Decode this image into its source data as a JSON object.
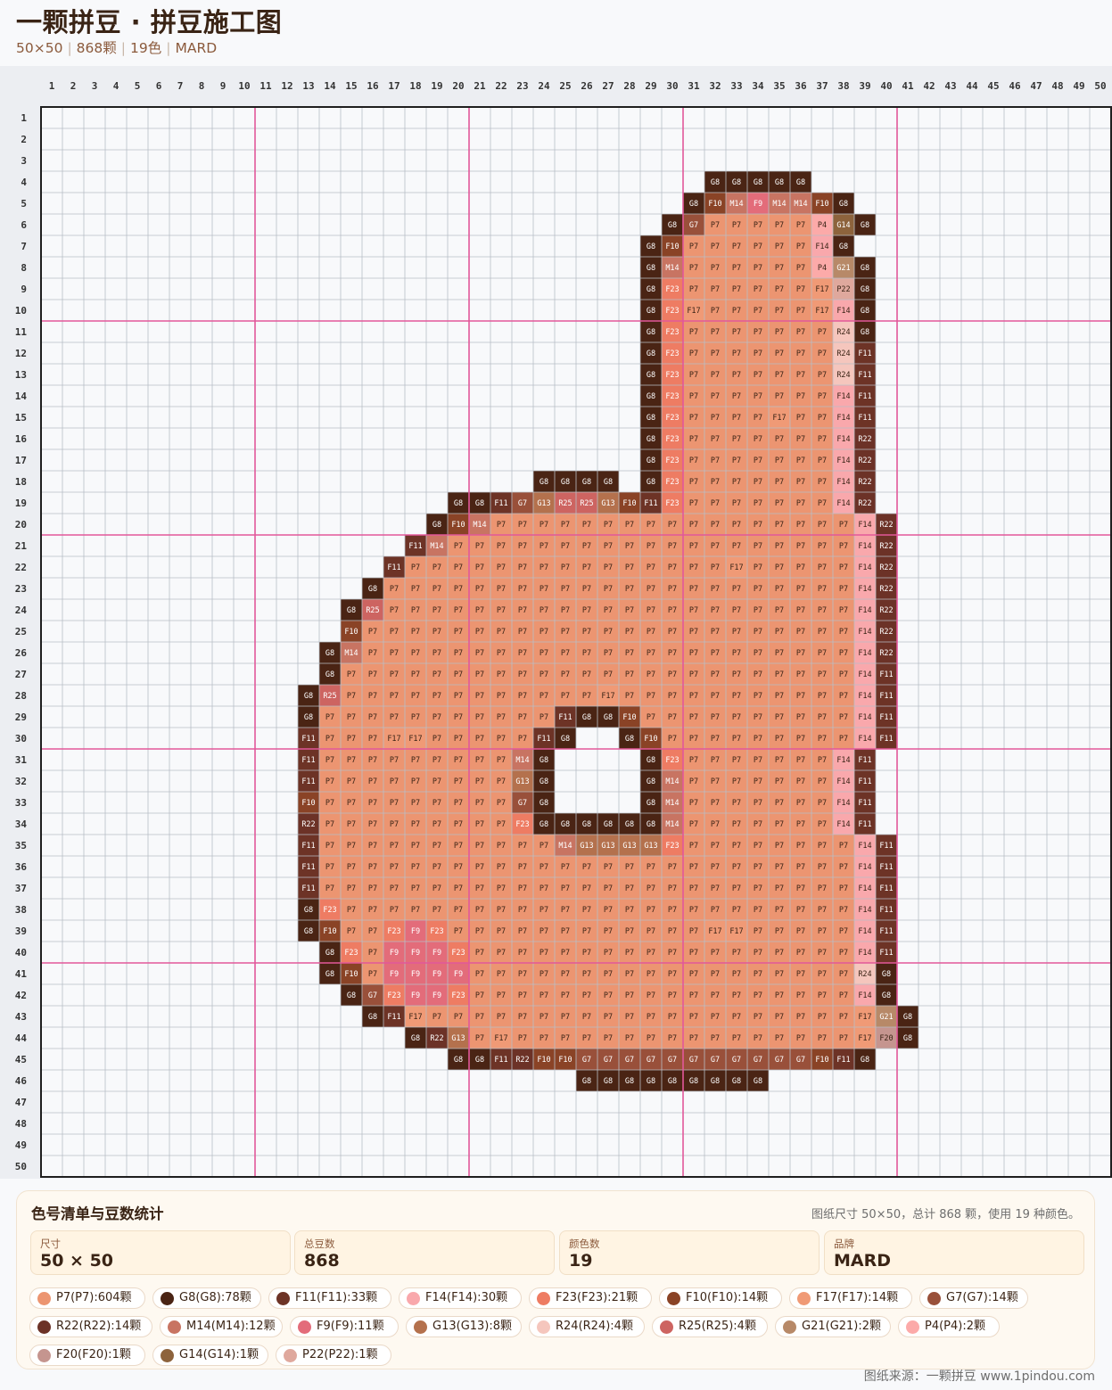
{
  "header": {
    "title": "一颗拼豆 · 拼豆施工图",
    "info": [
      "50×50",
      "868颗",
      "19色",
      "MARD"
    ]
  },
  "grid": {
    "cols": 50,
    "rows": 50,
    "major_every": 10,
    "major_color": "#e2589a",
    "minor_color": "#b8bec6",
    "border_color": "#1f1f1f",
    "cell_bg": "#f8f9fb",
    "rows_data": [
      [],
      [],
      [],
      [
        [
          32,
          "G8",
          "G8",
          "G8",
          "G8",
          "G8"
        ]
      ],
      [
        [
          31,
          "G8",
          "F10",
          "M14",
          "F9",
          "M14",
          "M14",
          "F10",
          "G8"
        ]
      ],
      [
        [
          30,
          "G8",
          "G7",
          "P7",
          "P7",
          "P7",
          "P7",
          "P7",
          "P4",
          "G14",
          "G8"
        ]
      ],
      [
        [
          29,
          "G8",
          "F10",
          "P7",
          "P7",
          "P7",
          "P7",
          "P7",
          "P7",
          "F14",
          "G8"
        ]
      ],
      [
        [
          29,
          "G8",
          "M14",
          "P7",
          "P7",
          "P7",
          "P7",
          "P7",
          "P7",
          "P4",
          "G21",
          "G8"
        ]
      ],
      [
        [
          29,
          "G8",
          "F23",
          "P7",
          "P7",
          "P7",
          "P7",
          "P7",
          "P7",
          "F17",
          "P22",
          "G8"
        ]
      ],
      [
        [
          29,
          "G8",
          "F23",
          "F17",
          "P7",
          "P7",
          "P7",
          "P7",
          "P7",
          "F17",
          "F14",
          "G8"
        ]
      ],
      [
        [
          29,
          "G8",
          "F23",
          "P7",
          "P7",
          "P7",
          "P7",
          "P7",
          "P7",
          "P7",
          "R24",
          "G8"
        ]
      ],
      [
        [
          29,
          "G8",
          "F23",
          "P7",
          "P7",
          "P7",
          "P7",
          "P7",
          "P7",
          "P7",
          "R24",
          "F11"
        ]
      ],
      [
        [
          29,
          "G8",
          "F23",
          "P7",
          "P7",
          "P7",
          "P7",
          "P7",
          "P7",
          "P7",
          "R24",
          "F11"
        ]
      ],
      [
        [
          29,
          "G8",
          "F23",
          "P7",
          "P7",
          "P7",
          "P7",
          "P7",
          "P7",
          "P7",
          "F14",
          "F11"
        ]
      ],
      [
        [
          29,
          "G8",
          "F23",
          "P7",
          "P7",
          "P7",
          "P7",
          "F17",
          "P7",
          "P7",
          "F14",
          "F11"
        ]
      ],
      [
        [
          29,
          "G8",
          "F23",
          "P7",
          "P7",
          "P7",
          "P7",
          "P7",
          "P7",
          "P7",
          "F14",
          "R22"
        ]
      ],
      [
        [
          29,
          "G8",
          "F23",
          "P7",
          "P7",
          "P7",
          "P7",
          "P7",
          "P7",
          "P7",
          "F14",
          "R22"
        ]
      ],
      [
        [
          24,
          "G8",
          "G8",
          "G8",
          "G8"
        ],
        [
          29,
          "G8",
          "F23",
          "P7",
          "P7",
          "P7",
          "P7",
          "P7",
          "P7",
          "P7",
          "F14",
          "R22"
        ]
      ],
      [
        [
          20,
          "G8",
          "G8",
          "F11",
          "G7",
          "G13",
          "R25",
          "R25",
          "G13",
          "F10",
          "F11",
          "F23",
          "P7",
          "P7",
          "P7",
          "P7",
          "P7",
          "P7",
          "P7",
          "F14",
          "R22"
        ]
      ],
      [
        [
          19,
          "G8",
          "F10",
          "M14",
          "P7",
          "P7",
          "P7",
          "P7",
          "P7",
          "P7",
          "P7",
          "P7",
          "P7",
          "P7",
          "P7",
          "P7",
          "P7",
          "P7",
          "P7",
          "P7",
          "P7",
          "F14",
          "R22"
        ]
      ],
      [
        [
          18,
          "F11",
          "M14",
          "P7",
          "P7",
          "P7",
          "P7",
          "P7",
          "P7",
          "P7",
          "P7",
          "P7",
          "P7",
          "P7",
          "P7",
          "P7",
          "P7",
          "P7",
          "P7",
          "P7",
          "P7",
          "P7",
          "F14",
          "R22"
        ]
      ],
      [
        [
          17,
          "F11",
          "P7",
          "P7",
          "P7",
          "P7",
          "P7",
          "P7",
          "P7",
          "P7",
          "P7",
          "P7",
          "P7",
          "P7",
          "P7",
          "P7",
          "P7",
          "F17",
          "P7",
          "P7",
          "P7",
          "P7",
          "P7",
          "F14",
          "R22"
        ]
      ],
      [
        [
          16,
          "G8",
          "P7",
          "P7",
          "P7",
          "P7",
          "P7",
          "P7",
          "P7",
          "P7",
          "P7",
          "P7",
          "P7",
          "P7",
          "P7",
          "P7",
          "P7",
          "P7",
          "P7",
          "P7",
          "P7",
          "P7",
          "P7",
          "P7",
          "F14",
          "R22"
        ]
      ],
      [
        [
          15,
          "G8",
          "R25",
          "P7",
          "P7",
          "P7",
          "P7",
          "P7",
          "P7",
          "P7",
          "P7",
          "P7",
          "P7",
          "P7",
          "P7",
          "P7",
          "P7",
          "P7",
          "P7",
          "P7",
          "P7",
          "P7",
          "P7",
          "P7",
          "P7",
          "F14",
          "R22"
        ]
      ],
      [
        [
          15,
          "F10",
          "P7",
          "P7",
          "P7",
          "P7",
          "P7",
          "P7",
          "P7",
          "P7",
          "P7",
          "P7",
          "P7",
          "P7",
          "P7",
          "P7",
          "P7",
          "P7",
          "P7",
          "P7",
          "P7",
          "P7",
          "P7",
          "P7",
          "P7",
          "F14",
          "R22"
        ]
      ],
      [
        [
          14,
          "G8",
          "M14",
          "P7",
          "P7",
          "P7",
          "P7",
          "P7",
          "P7",
          "P7",
          "P7",
          "P7",
          "P7",
          "P7",
          "P7",
          "P7",
          "P7",
          "P7",
          "P7",
          "P7",
          "P7",
          "P7",
          "P7",
          "P7",
          "P7",
          "P7",
          "F14",
          "R22"
        ]
      ],
      [
        [
          14,
          "G8",
          "P7",
          "P7",
          "P7",
          "P7",
          "P7",
          "P7",
          "P7",
          "P7",
          "P7",
          "P7",
          "P7",
          "P7",
          "P7",
          "P7",
          "P7",
          "P7",
          "P7",
          "P7",
          "P7",
          "P7",
          "P7",
          "P7",
          "P7",
          "P7",
          "F14",
          "F11"
        ]
      ],
      [
        [
          13,
          "G8",
          "R25",
          "P7",
          "P7",
          "P7",
          "P7",
          "P7",
          "P7",
          "P7",
          "P7",
          "P7",
          "P7",
          "P7",
          "P7",
          "F17",
          "P7",
          "P7",
          "P7",
          "P7",
          "P7",
          "P7",
          "P7",
          "P7",
          "P7",
          "P7",
          "P7",
          "F14",
          "F11"
        ]
      ],
      [
        [
          13,
          "G8",
          "P7",
          "P7",
          "P7",
          "P7",
          "P7",
          "P7",
          "P7",
          "P7",
          "P7",
          "P7",
          "P7",
          "F11",
          "G8",
          "G8",
          "F10",
          "P7",
          "P7",
          "P7",
          "P7",
          "P7",
          "P7",
          "P7",
          "P7",
          "P7",
          "P7",
          "F14",
          "F11"
        ]
      ],
      [
        [
          13,
          "F11",
          "P7",
          "P7",
          "P7",
          "F17",
          "F17",
          "P7",
          "P7",
          "P7",
          "P7",
          "P7",
          "F11",
          "G8"
        ],
        [
          28,
          "G8",
          "F10",
          "P7",
          "P7",
          "P7",
          "P7",
          "P7",
          "P7",
          "P7",
          "P7",
          "P7",
          "F14",
          "F11"
        ]
      ],
      [
        [
          13,
          "F11",
          "P7",
          "P7",
          "P7",
          "P7",
          "P7",
          "P7",
          "P7",
          "P7",
          "P7",
          "M14",
          "G8"
        ],
        [
          29,
          "G8",
          "F23",
          "P7",
          "P7",
          "P7",
          "P7",
          "P7",
          "P7",
          "P7",
          "F14",
          "F11"
        ]
      ],
      [
        [
          13,
          "F11",
          "P7",
          "P7",
          "P7",
          "P7",
          "P7",
          "P7",
          "P7",
          "P7",
          "P7",
          "G13",
          "G8"
        ],
        [
          29,
          "G8",
          "M14",
          "P7",
          "P7",
          "P7",
          "P7",
          "P7",
          "P7",
          "P7",
          "F14",
          "F11"
        ]
      ],
      [
        [
          13,
          "F10",
          "P7",
          "P7",
          "P7",
          "P7",
          "P7",
          "P7",
          "P7",
          "P7",
          "P7",
          "G7",
          "G8"
        ],
        [
          29,
          "G8",
          "M14",
          "P7",
          "P7",
          "P7",
          "P7",
          "P7",
          "P7",
          "P7",
          "F14",
          "F11"
        ]
      ],
      [
        [
          13,
          "R22",
          "P7",
          "P7",
          "P7",
          "P7",
          "P7",
          "P7",
          "P7",
          "P7",
          "P7",
          "F23",
          "G8",
          "G8",
          "G8",
          "G8",
          "G8",
          "G8",
          "M14",
          "P7",
          "P7",
          "P7",
          "P7",
          "P7",
          "P7",
          "P7",
          "F14",
          "F11"
        ]
      ],
      [
        [
          13,
          "F11",
          "P7",
          "P7",
          "P7",
          "P7",
          "P7",
          "P7",
          "P7",
          "P7",
          "P7",
          "P7",
          "P7",
          "M14",
          "G13",
          "G13",
          "G13",
          "G13",
          "F23",
          "P7",
          "P7",
          "P7",
          "P7",
          "P7",
          "P7",
          "P7",
          "P7",
          "F14",
          "F11"
        ]
      ],
      [
        [
          13,
          "F11",
          "P7",
          "P7",
          "P7",
          "P7",
          "P7",
          "P7",
          "P7",
          "P7",
          "P7",
          "P7",
          "P7",
          "P7",
          "P7",
          "P7",
          "P7",
          "P7",
          "P7",
          "P7",
          "P7",
          "P7",
          "P7",
          "P7",
          "P7",
          "P7",
          "P7",
          "F14",
          "F11"
        ]
      ],
      [
        [
          13,
          "F11",
          "P7",
          "P7",
          "P7",
          "P7",
          "P7",
          "P7",
          "P7",
          "P7",
          "P7",
          "P7",
          "P7",
          "P7",
          "P7",
          "P7",
          "P7",
          "P7",
          "P7",
          "P7",
          "P7",
          "P7",
          "P7",
          "P7",
          "P7",
          "P7",
          "P7",
          "F14",
          "F11"
        ]
      ],
      [
        [
          13,
          "G8",
          "F23",
          "P7",
          "P7",
          "P7",
          "P7",
          "P7",
          "P7",
          "P7",
          "P7",
          "P7",
          "P7",
          "P7",
          "P7",
          "P7",
          "P7",
          "P7",
          "P7",
          "P7",
          "P7",
          "P7",
          "P7",
          "P7",
          "P7",
          "P7",
          "P7",
          "F14",
          "F11"
        ]
      ],
      [
        [
          13,
          "G8",
          "F10",
          "P7",
          "P7",
          "F23",
          "F9",
          "F23",
          "P7",
          "P7",
          "P7",
          "P7",
          "P7",
          "P7",
          "P7",
          "P7",
          "P7",
          "P7",
          "P7",
          "P7",
          "F17",
          "F17",
          "P7",
          "P7",
          "P7",
          "P7",
          "P7",
          "F14",
          "F11"
        ]
      ],
      [
        [
          14,
          "G8",
          "F23",
          "P7",
          "F9",
          "F9",
          "F9",
          "F23",
          "P7",
          "P7",
          "P7",
          "P7",
          "P7",
          "P7",
          "P7",
          "P7",
          "P7",
          "P7",
          "P7",
          "P7",
          "P7",
          "P7",
          "P7",
          "P7",
          "P7",
          "P7",
          "F14",
          "F11"
        ]
      ],
      [
        [
          14,
          "G8",
          "F10",
          "P7",
          "F9",
          "F9",
          "F9",
          "F9",
          "P7",
          "P7",
          "P7",
          "P7",
          "P7",
          "P7",
          "P7",
          "P7",
          "P7",
          "P7",
          "P7",
          "P7",
          "P7",
          "P7",
          "P7",
          "P7",
          "P7",
          "P7",
          "R24",
          "G8"
        ]
      ],
      [
        [
          15,
          "G8",
          "G7",
          "F23",
          "F9",
          "F9",
          "F23",
          "P7",
          "P7",
          "P7",
          "P7",
          "P7",
          "P7",
          "P7",
          "P7",
          "P7",
          "P7",
          "P7",
          "P7",
          "P7",
          "P7",
          "P7",
          "P7",
          "P7",
          "P7",
          "F14",
          "G8"
        ]
      ],
      [
        [
          16,
          "G8",
          "F11",
          "F17",
          "P7",
          "P7",
          "P7",
          "P7",
          "P7",
          "P7",
          "P7",
          "P7",
          "P7",
          "P7",
          "P7",
          "P7",
          "P7",
          "P7",
          "P7",
          "P7",
          "P7",
          "P7",
          "P7",
          "P7",
          "F17",
          "G21",
          "G8"
        ]
      ],
      [
        [
          18,
          "G8",
          "R22",
          "G13",
          "P7",
          "F17",
          "P7",
          "P7",
          "P7",
          "P7",
          "P7",
          "P7",
          "P7",
          "P7",
          "P7",
          "P7",
          "P7",
          "P7",
          "P7",
          "P7",
          "P7",
          "P7",
          "F17",
          "F20",
          "G8"
        ]
      ],
      [
        [
          20,
          "G8",
          "G8",
          "F11",
          "R22",
          "F10",
          "F10",
          "G7",
          "G7",
          "G7",
          "G7",
          "G7",
          "G7",
          "G7",
          "G7",
          "G7",
          "G7",
          "G7",
          "F10",
          "F11",
          "G8"
        ]
      ],
      [
        [
          26,
          "G8",
          "G8",
          "G8",
          "G8",
          "G8",
          "G8",
          "G8",
          "G8",
          "G8"
        ]
      ],
      [],
      [],
      [],
      []
    ]
  },
  "palette": {
    "P7": {
      "color": "#ec9571",
      "text": "#3b2416"
    },
    "G8": {
      "color": "#4a2414",
      "text": "#ffffff"
    },
    "F11": {
      "color": "#6d3326",
      "text": "#ffffff"
    },
    "F14": {
      "color": "#f9a8ac",
      "text": "#3b2416"
    },
    "F23": {
      "color": "#ee7c63",
      "text": "#ffffff"
    },
    "F10": {
      "color": "#8a4326",
      "text": "#ffffff"
    },
    "F17": {
      "color": "#f09a76",
      "text": "#3b2416"
    },
    "G7": {
      "color": "#99503a",
      "text": "#ffffff"
    },
    "R22": {
      "color": "#6c3227",
      "text": "#ffffff"
    },
    "M14": {
      "color": "#c87462",
      "text": "#ffffff"
    },
    "F9": {
      "color": "#e36c7a",
      "text": "#ffffff"
    },
    "G13": {
      "color": "#b4714d",
      "text": "#ffffff"
    },
    "R24": {
      "color": "#f5c6bd",
      "text": "#3b2416"
    },
    "R25": {
      "color": "#cd6461",
      "text": "#ffffff"
    },
    "G21": {
      "color": "#b78968",
      "text": "#ffffff"
    },
    "P4": {
      "color": "#fcaaa9",
      "text": "#3b2416"
    },
    "F20": {
      "color": "#c5958f",
      "text": "#3b2416"
    },
    "G14": {
      "color": "#8d633c",
      "text": "#ffffff"
    },
    "P22": {
      "color": "#dfa89d",
      "text": "#3b2416"
    }
  },
  "panel": {
    "title": "色号清单与豆数统计",
    "note": "图纸尺寸 50×50，总计 868 颗，使用 19 种颜色。",
    "stats": [
      {
        "label": "尺寸",
        "value": "50 × 50"
      },
      {
        "label": "总豆数",
        "value": "868"
      },
      {
        "label": "颜色数",
        "value": "19"
      },
      {
        "label": "品牌",
        "value": "MARD"
      }
    ],
    "legend": [
      {
        "code": "P7",
        "label": "P7(P7):604颗"
      },
      {
        "code": "G8",
        "label": "G8(G8):78颗"
      },
      {
        "code": "F11",
        "label": "F11(F11):33颗"
      },
      {
        "code": "F14",
        "label": "F14(F14):30颗"
      },
      {
        "code": "F23",
        "label": "F23(F23):21颗"
      },
      {
        "code": "F10",
        "label": "F10(F10):14颗"
      },
      {
        "code": "F17",
        "label": "F17(F17):14颗"
      },
      {
        "code": "G7",
        "label": "G7(G7):14颗"
      },
      {
        "code": "R22",
        "label": "R22(R22):14颗"
      },
      {
        "code": "M14",
        "label": "M14(M14):12颗"
      },
      {
        "code": "F9",
        "label": "F9(F9):11颗"
      },
      {
        "code": "G13",
        "label": "G13(G13):8颗"
      },
      {
        "code": "R24",
        "label": "R24(R24):4颗"
      },
      {
        "code": "R25",
        "label": "R25(R25):4颗"
      },
      {
        "code": "G21",
        "label": "G21(G21):2颗"
      },
      {
        "code": "P4",
        "label": "P4(P4):2颗"
      },
      {
        "code": "F20",
        "label": "F20(F20):1颗"
      },
      {
        "code": "G14",
        "label": "G14(G14):1颗"
      },
      {
        "code": "P22",
        "label": "P22(P22):1颗"
      }
    ]
  },
  "footer": {
    "source": "图纸来源：一颗拼豆 www.1pindou.com"
  }
}
